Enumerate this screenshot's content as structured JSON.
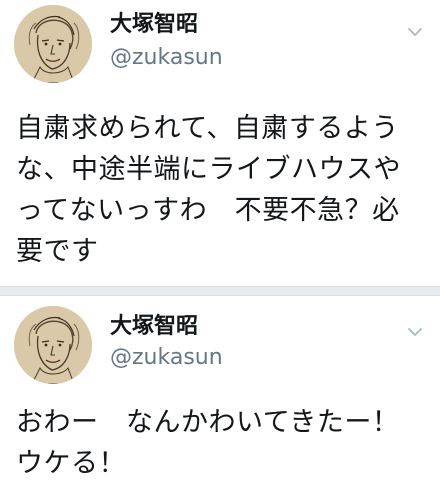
{
  "tweets": [
    {
      "display_name": "大塚智昭",
      "handle": "@zukasun",
      "text": "自粛求められて、自粛するような、中途半端にライブハウスやってないっすわ　不要不急？必要です",
      "avatar_icon": "profile-sketch-portrait",
      "menu_icon": "chevron-down-icon"
    },
    {
      "display_name": "大塚智昭",
      "handle": "@zukasun",
      "text": "おわー　なんかわいてきたー！ウケる！",
      "avatar_icon": "profile-sketch-portrait",
      "menu_icon": "chevron-down-icon"
    }
  ],
  "colors": {
    "text": "#14171a",
    "secondary": "#657786",
    "separator": "#e6ecf0",
    "avatar_bg": "#d9c9a9"
  }
}
